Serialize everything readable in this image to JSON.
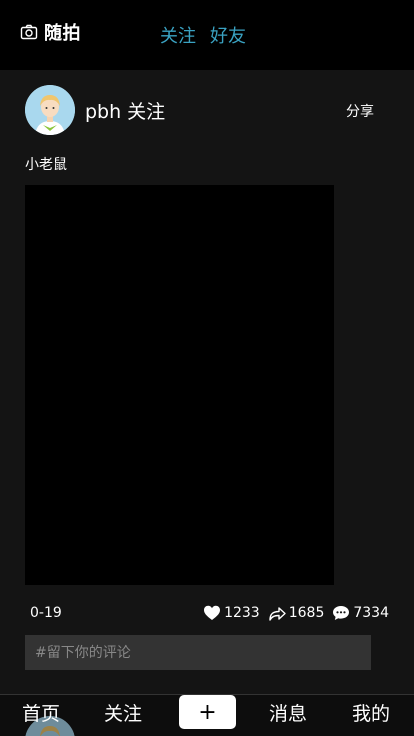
{
  "header": {
    "camera_label": "随拍",
    "tabs": [
      "关注",
      "好友"
    ]
  },
  "post": {
    "username": "pbh",
    "follow_label": "关注",
    "share_label": "分享",
    "caption": "小老鼠",
    "date": "0-19",
    "likes": "1233",
    "shares": "1685",
    "comments": "7334",
    "comment_placeholder": "#留下你的评论"
  },
  "nav": {
    "home": "首页",
    "follow": "关注",
    "add": "+",
    "messages": "消息",
    "me": "我的"
  },
  "colors": {
    "accent": "#3aa2c2",
    "background": "#141414"
  }
}
